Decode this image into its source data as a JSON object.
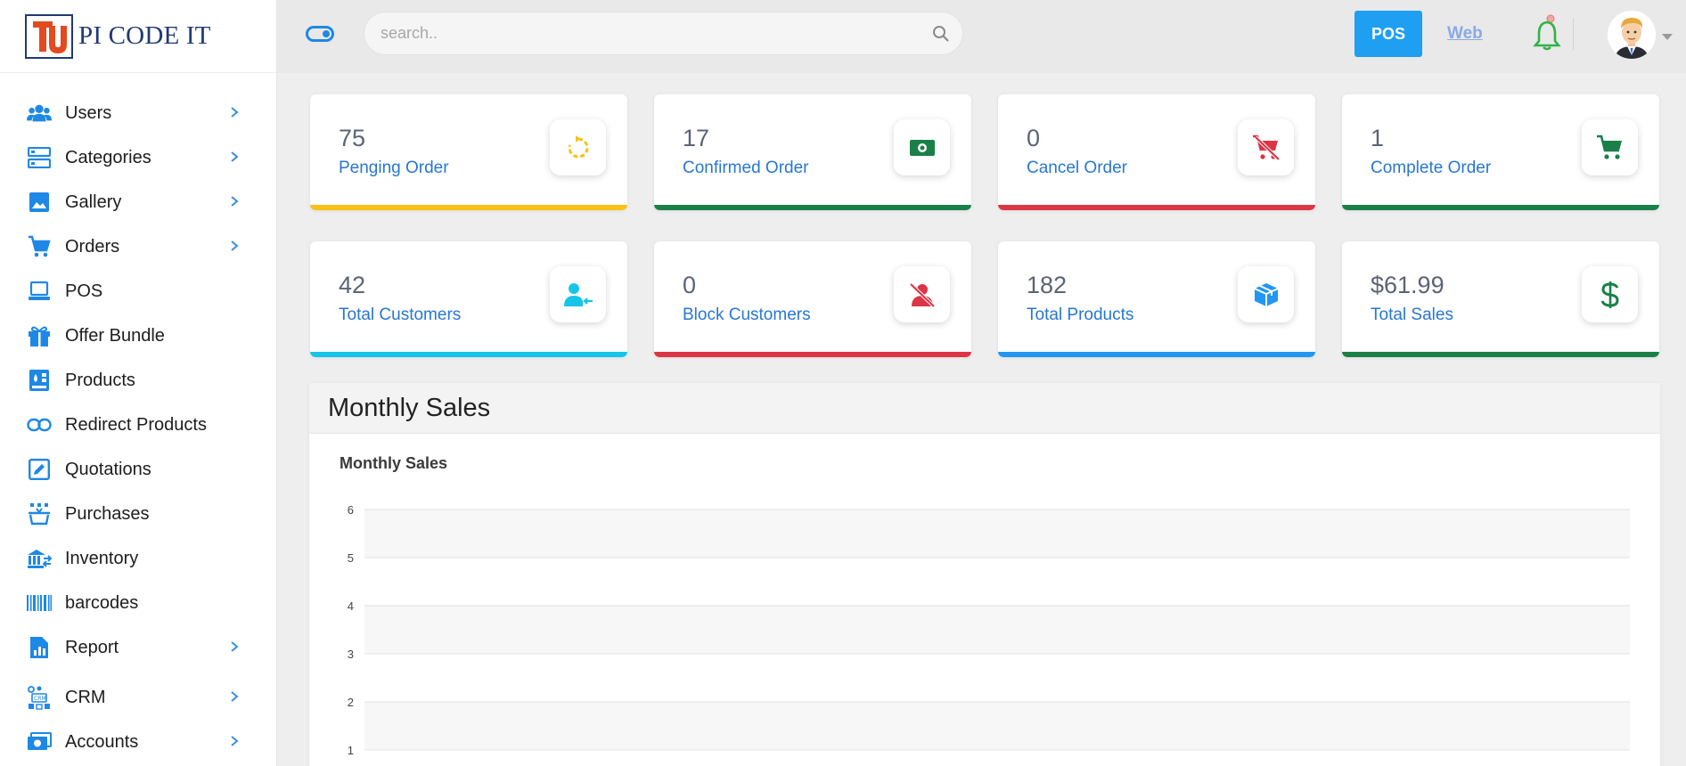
{
  "brand": {
    "name": "PI CODE IT"
  },
  "sidebar": {
    "items": [
      {
        "label": "Users",
        "icon": "users-icon",
        "chevron": true
      },
      {
        "label": "Categories",
        "icon": "categories-icon",
        "chevron": true
      },
      {
        "label": "Gallery",
        "icon": "image-icon",
        "chevron": true
      },
      {
        "label": "Orders",
        "icon": "cart-icon",
        "chevron": true
      },
      {
        "label": "POS",
        "icon": "laptop-icon",
        "chevron": false
      },
      {
        "label": "Offer Bundle",
        "icon": "gift-icon",
        "chevron": false
      },
      {
        "label": "Products",
        "icon": "products-icon",
        "chevron": false
      },
      {
        "label": "Redirect Products",
        "icon": "link-icon",
        "chevron": false
      },
      {
        "label": "Quotations",
        "icon": "edit-icon",
        "chevron": false
      },
      {
        "label": "Purchases",
        "icon": "basket-icon",
        "chevron": false
      },
      {
        "label": "Inventory",
        "icon": "warehouse-icon",
        "chevron": false
      },
      {
        "label": "barcodes",
        "icon": "barcode-icon",
        "chevron": false
      },
      {
        "label": "Report",
        "icon": "report-icon",
        "chevron": true
      },
      {
        "label": "CRM",
        "icon": "crm-icon",
        "chevron": true
      },
      {
        "label": "Accounts",
        "icon": "money-icon",
        "chevron": true
      }
    ]
  },
  "topbar": {
    "search_placeholder": "search..",
    "pos_label": "POS",
    "web_label": "Web"
  },
  "colors": {
    "yellow": "#f9c01a",
    "green": "#1a8048",
    "red": "#dc3545",
    "cyan": "#16c5e8",
    "blue": "#2196f3",
    "link": "#2777d3"
  },
  "stats": [
    {
      "value": "75",
      "label": "Penging Order",
      "icon": "refresh-icon",
      "color": "#f9c01a"
    },
    {
      "value": "17",
      "label": "Confirmed Order",
      "icon": "money-bill-icon",
      "color": "#1a8048"
    },
    {
      "value": "0",
      "label": "Cancel Order",
      "icon": "cart-cancel-icon",
      "color": "#dc3545"
    },
    {
      "value": "1",
      "label": "Complete Order",
      "icon": "cart-icon",
      "color": "#1a8048"
    },
    {
      "value": "42",
      "label": "Total Customers",
      "icon": "user-arrow-icon",
      "color": "#16c5e8"
    },
    {
      "value": "0",
      "label": "Block Customers",
      "icon": "user-slash-icon",
      "color": "#dc3545"
    },
    {
      "value": "182",
      "label": "Total Products",
      "icon": "box-icon",
      "color": "#2196f3"
    },
    {
      "value": "$61.99",
      "label": "Total Sales",
      "icon": "dollar-icon",
      "color": "#1a8048"
    }
  ],
  "monthly_sales": {
    "panel_title": "Monthly Sales",
    "chart_title": "Monthly Sales"
  },
  "chart_data": {
    "type": "bar",
    "title": "Monthly Sales",
    "xlabel": "",
    "ylabel": "",
    "categories": [],
    "values": [],
    "ylim": [
      0,
      6
    ],
    "y_ticks": [
      "6",
      "5",
      "4",
      "3",
      "2",
      "1"
    ],
    "grid": true,
    "legend": "none"
  }
}
